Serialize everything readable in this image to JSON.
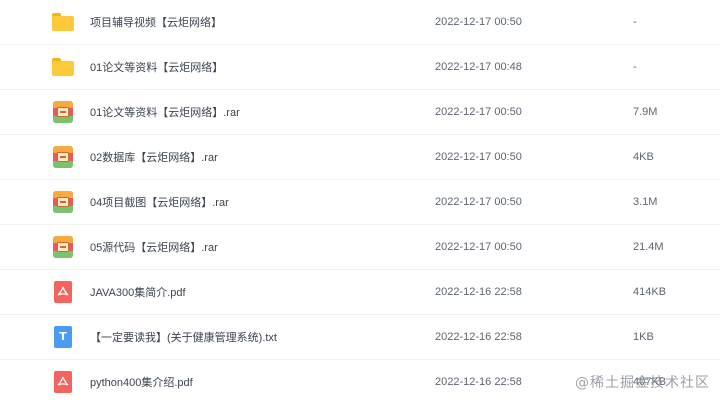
{
  "files": [
    {
      "name": "项目辅导视频【云炬网络】",
      "date": "2022-12-17 00:50",
      "size": "-",
      "type": "folder-icon"
    },
    {
      "name": "01论文等资料【云炬网络】",
      "date": "2022-12-17 00:48",
      "size": "-",
      "type": "folder-icon"
    },
    {
      "name": "01论文等资料【云炬网络】.rar",
      "date": "2022-12-17 00:50",
      "size": "7.9M",
      "type": "rar-archive-icon"
    },
    {
      "name": "02数据库【云炬网络】.rar",
      "date": "2022-12-17 00:50",
      "size": "4KB",
      "type": "rar-archive-icon"
    },
    {
      "name": "04项目截图【云炬网络】.rar",
      "date": "2022-12-17 00:50",
      "size": "3.1M",
      "type": "rar-archive-icon"
    },
    {
      "name": "05源代码【云炬网络】.rar",
      "date": "2022-12-17 00:50",
      "size": "21.4M",
      "type": "rar-archive-icon"
    },
    {
      "name": "JAVA300集简介.pdf",
      "date": "2022-12-16 22:58",
      "size": "414KB",
      "type": "pdf-file-icon"
    },
    {
      "name": "【一定要读我】(关于健康管理系统).txt",
      "date": "2022-12-16 22:58",
      "size": "1KB",
      "type": "txt-file-icon"
    },
    {
      "name": "python400集介绍.pdf",
      "date": "2022-12-16 22:58",
      "size": "407KB",
      "type": "pdf-file-icon"
    }
  ],
  "watermark": "@稀土掘金技术社区",
  "colors": {
    "folder": "#fcc93a",
    "pdf": "#f6625e",
    "txt": "#4a9bf2"
  }
}
